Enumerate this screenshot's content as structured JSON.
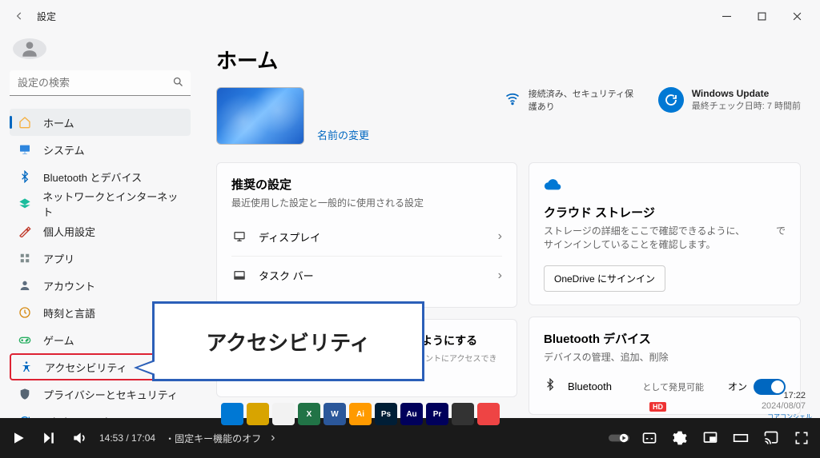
{
  "window": {
    "title": "設定"
  },
  "search": {
    "placeholder": "設定の検索"
  },
  "sidebar": {
    "items": [
      {
        "label": "ホーム",
        "icon": "home",
        "color": "#f5b041"
      },
      {
        "label": "システム",
        "icon": "system",
        "color": "#2e86de"
      },
      {
        "label": "Bluetooth とデバイス",
        "icon": "bluetooth",
        "color": "#0067c0"
      },
      {
        "label": "ネットワークとインターネット",
        "icon": "network",
        "color": "#1abc9c"
      },
      {
        "label": "個人用設定",
        "icon": "personalize",
        "color": "#c0392b"
      },
      {
        "label": "アプリ",
        "icon": "apps",
        "color": "#7f8c8d"
      },
      {
        "label": "アカウント",
        "icon": "account",
        "color": "#5d6d7e"
      },
      {
        "label": "時刻と言語",
        "icon": "time",
        "color": "#d68910"
      },
      {
        "label": "ゲーム",
        "icon": "games",
        "color": "#27ae60"
      },
      {
        "label": "アクセシビリティ",
        "icon": "accessibility",
        "color": "#0067c0"
      },
      {
        "label": "プライバシーとセキュリティ",
        "icon": "privacy",
        "color": "#566573"
      },
      {
        "label": "Windows Update",
        "icon": "update",
        "color": "#0078d4"
      }
    ]
  },
  "page": {
    "title": "ホーム",
    "rename": "名前の変更",
    "wifi_status": "接続済み、セキュリティ保護あり",
    "wu_title": "Windows Update",
    "wu_sub": "最終チェック日時: 7 時間前"
  },
  "recommended": {
    "title": "推奨の設定",
    "sub": "最近使用した設定と一般的に使用される設定",
    "rows": [
      {
        "label": "ディスプレイ",
        "icon": "display"
      },
      {
        "label": "タスク バー",
        "icon": "taskbar"
      }
    ]
  },
  "cloud": {
    "title": "クラウド ストレージ",
    "sub_a": "ストレージの詳細をここで確認できるように、",
    "sub_b": "で",
    "sub_c": "サインインしていることを確認します。",
    "button": "OneDrive にサインイン"
  },
  "account_card": {
    "title": "引き続きアカウントにアクセスできるようにする",
    "sub": "回復用のメール アドレスを追加して、いつでもアカウントにアクセスできるように"
  },
  "bt_card": {
    "title": "Bluetooth デバイス",
    "sub": "デバイスの管理、追加、削除",
    "row_label": "Bluetooth",
    "discoverable": "として発見可能",
    "on": "オン"
  },
  "annotation": {
    "text": "アクセシビリティ"
  },
  "video": {
    "time": "14:53 / 17:04",
    "chapter": "・固定キー機能のオフ"
  },
  "taskbar_apps": [
    {
      "bg": "#0078d4",
      "txt": ""
    },
    {
      "bg": "#d8a400",
      "txt": ""
    },
    {
      "bg": "#f2f2f2",
      "txt": ""
    },
    {
      "bg": "#217346",
      "txt": "X"
    },
    {
      "bg": "#2b579a",
      "txt": "W"
    },
    {
      "bg": "#ff9a00",
      "txt": "Ai"
    },
    {
      "bg": "#001e36",
      "txt": "Ps"
    },
    {
      "bg": "#00005b",
      "txt": "Au"
    },
    {
      "bg": "#00005b",
      "txt": "Pr"
    },
    {
      "bg": "#333",
      "txt": ""
    },
    {
      "bg": "#e44",
      "txt": ""
    }
  ],
  "clock": {
    "time": "17:22",
    "date": "2024/08/07"
  },
  "hd_badge": "HD",
  "corner": "コアコンシェル"
}
